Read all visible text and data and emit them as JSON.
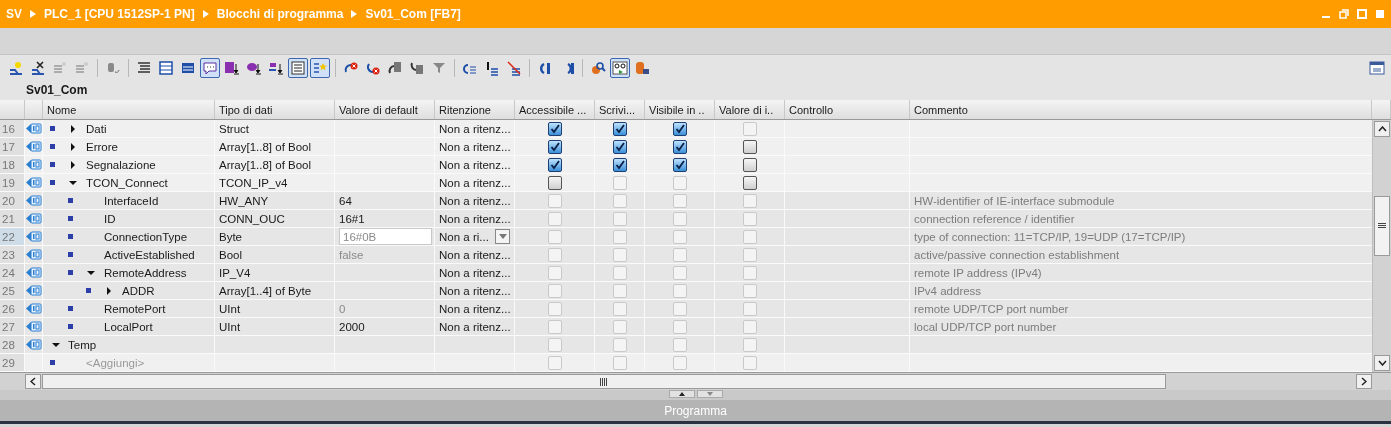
{
  "breadcrumb": [
    "SV",
    "PLC_1 [CPU 1512SP-1 PN]",
    "Blocchi di programma",
    "Sv01_Com [FB7]"
  ],
  "toolbar": [
    {
      "kind": "add-row",
      "on": false
    },
    {
      "kind": "delete-row",
      "on": false
    },
    {
      "kind": "lines-star",
      "on": false
    },
    {
      "kind": "lines-star",
      "on": false
    },
    {
      "kind": "separator"
    },
    {
      "kind": "cylinder-arrow",
      "on": false
    },
    {
      "kind": "separator"
    },
    {
      "kind": "lines",
      "on": false
    },
    {
      "kind": "window",
      "on": false
    },
    {
      "kind": "window-dark",
      "on": false
    },
    {
      "kind": "bubble",
      "on": true
    },
    {
      "kind": "tag-down",
      "on": false
    },
    {
      "kind": "bubble-down",
      "on": false
    },
    {
      "kind": "add-down",
      "on": false
    },
    {
      "kind": "list",
      "on": true
    },
    {
      "kind": "star-list",
      "on": true
    },
    {
      "kind": "separator"
    },
    {
      "kind": "undo-cross",
      "on": false
    },
    {
      "kind": "redo-cross",
      "on": false
    },
    {
      "kind": "undo-page",
      "on": false
    },
    {
      "kind": "redo-page",
      "on": false
    },
    {
      "kind": "funnel",
      "on": false
    },
    {
      "kind": "separator"
    },
    {
      "kind": "undo-lines",
      "on": false
    },
    {
      "kind": "cursor-lines",
      "on": false
    },
    {
      "kind": "strike-lines",
      "on": false
    },
    {
      "kind": "separator"
    },
    {
      "kind": "undo-bar",
      "on": false
    },
    {
      "kind": "redo-bar",
      "on": false
    },
    {
      "kind": "separator"
    },
    {
      "kind": "magnifier",
      "on": false
    },
    {
      "kind": "glasses",
      "on": true
    },
    {
      "kind": "cylinder-lock",
      "on": false
    }
  ],
  "block_title": "Sv01_Com",
  "columns": [
    "Nome",
    "Tipo di dati",
    "Valore di default",
    "Ritenzione",
    "Accessibile ...",
    "Scrivi...",
    "Visibile in ..",
    "Valore di i..",
    "Controllo",
    "Commento"
  ],
  "rows": [
    {
      "kind": "member",
      "number": "16",
      "name": "Dati",
      "expanded": false,
      "type": "Struct",
      "retention": "Non a ritenz...",
      "selected": false,
      "checks": [
        {
          "checked": true,
          "disabled": false
        },
        {
          "checked": true,
          "disabled": false
        },
        {
          "checked": true,
          "disabled": false
        },
        {
          "checked": false,
          "disabled": true
        }
      ]
    },
    {
      "kind": "member",
      "number": "17",
      "name": "Errore",
      "expanded": false,
      "type": "Array[1..8] of Bool",
      "retention": "Non a ritenz...",
      "selected": false,
      "checks": [
        {
          "checked": true,
          "disabled": false
        },
        {
          "checked": true,
          "disabled": false
        },
        {
          "checked": true,
          "disabled": false
        },
        {
          "checked": false,
          "disabled": false
        }
      ]
    },
    {
      "kind": "member",
      "number": "18",
      "name": "Segnalazione",
      "expanded": false,
      "type": "Array[1..8] of Bool",
      "retention": "Non a ritenz...",
      "selected": false,
      "checks": [
        {
          "checked": true,
          "disabled": false
        },
        {
          "checked": true,
          "disabled": false
        },
        {
          "checked": true,
          "disabled": false
        },
        {
          "checked": false,
          "disabled": false
        }
      ]
    },
    {
      "kind": "member",
      "number": "19",
      "name": "TCON_Connect",
      "expanded": true,
      "type": "TCON_IP_v4",
      "retention": "Non a ritenz...",
      "selected": false,
      "checks": [
        {
          "checked": false,
          "disabled": false
        },
        {
          "checked": false,
          "disabled": true
        },
        {
          "checked": false,
          "disabled": true
        },
        {
          "checked": false,
          "disabled": false
        }
      ],
      "children": [
        {
          "kind": "member",
          "number": "20",
          "name": "InterfaceId",
          "type": "HW_ANY",
          "default": "64",
          "default_dimmed": false,
          "retention": "Non a ritenz...",
          "selected": false,
          "checks": [
            {
              "checked": false,
              "disabled": true
            },
            {
              "checked": false,
              "disabled": true
            },
            {
              "checked": false,
              "disabled": true
            },
            {
              "checked": false,
              "disabled": true
            }
          ],
          "comment": "HW-identifier of IE-interface submodule"
        },
        {
          "kind": "member",
          "number": "21",
          "name": "ID",
          "type": "CONN_OUC",
          "default": "16#1",
          "default_dimmed": false,
          "retention": "Non a ritenz...",
          "selected": false,
          "checks": [
            {
              "checked": false,
              "disabled": true
            },
            {
              "checked": false,
              "disabled": true
            },
            {
              "checked": false,
              "disabled": true
            },
            {
              "checked": false,
              "disabled": true
            }
          ],
          "comment": "connection reference / identifier"
        },
        {
          "kind": "member",
          "number": "22",
          "name": "ConnectionType",
          "type": "Byte",
          "default": "16#0B",
          "default_dimmed": true,
          "retention": "Non a ri...",
          "selected": true,
          "checks": [
            {
              "checked": false,
              "disabled": true
            },
            {
              "checked": false,
              "disabled": true
            },
            {
              "checked": false,
              "disabled": true
            },
            {
              "checked": false,
              "disabled": true
            }
          ],
          "comment": "type of connection: 11=TCP/IP, 19=UDP (17=TCP/IP)"
        },
        {
          "kind": "member",
          "number": "23",
          "name": "ActiveEstablished",
          "type": "Bool",
          "default": "false",
          "default_dimmed": true,
          "retention": "Non a ritenz...",
          "selected": false,
          "checks": [
            {
              "checked": false,
              "disabled": true
            },
            {
              "checked": false,
              "disabled": true
            },
            {
              "checked": false,
              "disabled": true
            },
            {
              "checked": false,
              "disabled": true
            }
          ],
          "comment": "active/passive connection establishment"
        },
        {
          "kind": "member",
          "number": "24",
          "name": "RemoteAddress",
          "expanded": true,
          "type": "IP_V4",
          "retention": "Non a ritenz...",
          "selected": false,
          "checks": [
            {
              "checked": false,
              "disabled": true
            },
            {
              "checked": false,
              "disabled": true
            },
            {
              "checked": false,
              "disabled": true
            },
            {
              "checked": false,
              "disabled": true
            }
          ],
          "comment": "remote IP address (IPv4)",
          "children": [
            {
              "kind": "member",
              "number": "25",
              "name": "ADDR",
              "expanded": false,
              "type": "Array[1..4] of Byte",
              "retention": "Non a ritenz...",
              "selected": false,
              "checks": [
                {
                  "checked": false,
                  "disabled": true
                },
                {
                  "checked": false,
                  "disabled": true
                },
                {
                  "checked": false,
                  "disabled": true
                },
                {
                  "checked": false,
                  "disabled": true
                }
              ],
              "comment": "IPv4 address"
            }
          ]
        },
        {
          "kind": "member",
          "number": "26",
          "name": "RemotePort",
          "type": "UInt",
          "default": "0",
          "default_dimmed": true,
          "retention": "Non a ritenz...",
          "selected": false,
          "checks": [
            {
              "checked": false,
              "disabled": true
            },
            {
              "checked": false,
              "disabled": true
            },
            {
              "checked": false,
              "disabled": true
            },
            {
              "checked": false,
              "disabled": true
            }
          ],
          "comment": "remote UDP/TCP port number"
        },
        {
          "kind": "member",
          "number": "27",
          "name": "LocalPort",
          "type": "UInt",
          "default": "2000",
          "default_dimmed": false,
          "retention": "Non a ritenz...",
          "selected": false,
          "checks": [
            {
              "checked": false,
              "disabled": true
            },
            {
              "checked": false,
              "disabled": true
            },
            {
              "checked": false,
              "disabled": true
            },
            {
              "checked": false,
              "disabled": true
            }
          ],
          "comment": "local UDP/TCP port number"
        }
      ]
    },
    {
      "kind": "section",
      "number": "28",
      "name": "Temp",
      "expanded": true,
      "selected": false,
      "checks": [
        {
          "checked": false,
          "disabled": true
        },
        {
          "checked": false,
          "disabled": true
        },
        {
          "checked": false,
          "disabled": true
        },
        {
          "checked": false,
          "disabled": true
        }
      ],
      "children": [
        {
          "kind": "placeholder",
          "number": "29",
          "name": "<Aggiungi>",
          "selected": false,
          "checks": [
            {
              "checked": false,
              "disabled": true
            },
            {
              "checked": false,
              "disabled": true
            },
            {
              "checked": false,
              "disabled": true
            },
            {
              "checked": false,
              "disabled": true
            }
          ]
        }
      ]
    }
  ],
  "status_bar": "Programma"
}
